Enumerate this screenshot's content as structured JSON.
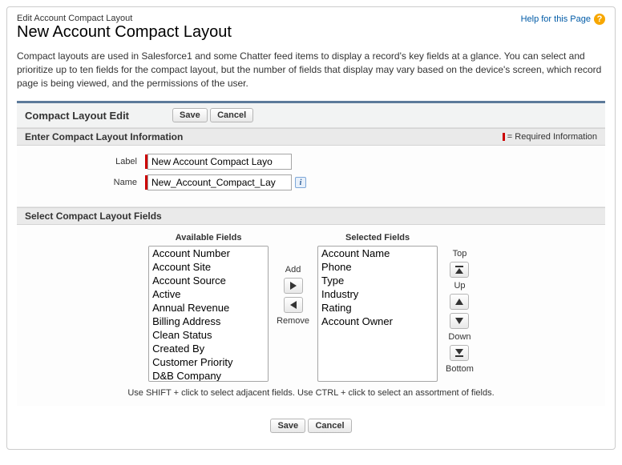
{
  "header": {
    "edit_label": "Edit Account Compact Layout",
    "title": "New Account Compact Layout",
    "help_link": "Help for this Page"
  },
  "intro": "Compact layouts are used in Salesforce1 and some Chatter feed items to display a record's key fields at a glance. You can select and prioritize up to ten fields for the compact layout, but the number of fields that display may vary based on the device's screen, which record page is being viewed, and the permissions of the user.",
  "section": {
    "edit_title": "Compact Layout Edit",
    "save_label": "Save",
    "cancel_label": "Cancel"
  },
  "info_section": {
    "title": "Enter Compact Layout Information",
    "required_text": "= Required Information",
    "label_field_label": "Label",
    "label_value": "New Account Compact Layo",
    "name_field_label": "Name",
    "name_value": "New_Account_Compact_Lay"
  },
  "fields_section": {
    "title": "Select Compact Layout Fields",
    "available_title": "Available Fields",
    "selected_title": "Selected Fields",
    "available": [
      "Account Number",
      "Account Site",
      "Account Source",
      "Active",
      "Annual Revenue",
      "Billing Address",
      "Clean Status",
      "Created By",
      "Customer Priority",
      "D&B Company"
    ],
    "selected": [
      "Account Name",
      "Phone",
      "Type",
      "Industry",
      "Rating",
      "Account Owner"
    ],
    "add_label": "Add",
    "remove_label": "Remove",
    "top_label": "Top",
    "up_label": "Up",
    "down_label": "Down",
    "bottom_label": "Bottom",
    "hint": "Use SHIFT + click to select adjacent fields. Use CTRL + click to select an assortment of fields."
  }
}
